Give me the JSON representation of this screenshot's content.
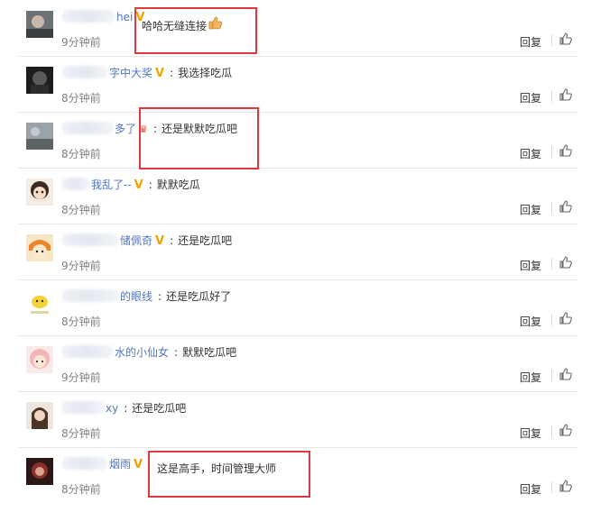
{
  "reply_label": "回复",
  "comments": [
    {
      "username": "hei",
      "verified": true,
      "text": "哈哈无缝连接",
      "emoji": "thumbs-up-icon",
      "time": "9分钟前"
    },
    {
      "username": "字中大奖",
      "verified": true,
      "text": "我选择吃瓜",
      "time": "8分钟前"
    },
    {
      "username": "多了",
      "verified": false,
      "badge": "crown-icon",
      "text": "还是默默吃瓜吧",
      "time": "8分钟前"
    },
    {
      "username": "我乱了--",
      "verified": true,
      "text": "默默吃瓜",
      "time": "8分钟前"
    },
    {
      "username": "储佩奇",
      "verified": true,
      "text": "还是吃瓜吧",
      "time": "9分钟前"
    },
    {
      "username": "的眼线",
      "verified": false,
      "text": "还是吃瓜好了",
      "time": "8分钟前"
    },
    {
      "username": "水的小仙女",
      "verified": false,
      "text": "默默吃瓜吧",
      "time": "9分钟前"
    },
    {
      "username": "xy",
      "verified": false,
      "text": "还是吃瓜吧",
      "time": "8分钟前"
    },
    {
      "username": "烟雨",
      "verified": true,
      "text": "这是高手，时间管理大师",
      "time": "8分钟前"
    }
  ],
  "colors": {
    "username": "#5075c0",
    "verified": "#f0a300",
    "highlight_box": "#e0383e",
    "time": "#808080"
  }
}
